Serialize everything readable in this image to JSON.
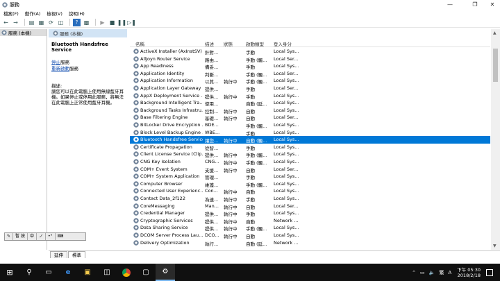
{
  "window": {
    "title": "服務"
  },
  "menu": [
    "檔案(F)",
    "動作(A)",
    "檢視(V)",
    "說明(H)"
  ],
  "tree": {
    "root_label": "服務 (本機)"
  },
  "content_header": "服務 (本機)",
  "description": {
    "service_name": "Bluetooth Handsfree Service",
    "stop_link": "停止",
    "stop_suffix": "服務",
    "restart_link": "重新啟動",
    "restart_suffix": "服務",
    "label": "描述:",
    "text": "讓您可以在此電腦上使用無線藍牙耳機。如果停止或停用此服務，將無法在此電腦上正常使用藍牙耳機。"
  },
  "columns": [
    "名稱",
    "描述",
    "狀態",
    "啟動類型",
    "登入身分"
  ],
  "rows": [
    {
      "name": "ActiveX Installer (AxInstSV)",
      "desc": "針對...",
      "status": "",
      "startup": "手動",
      "logon": "Local Sys..."
    },
    {
      "name": "AllJoyn Router Service",
      "desc": "路由...",
      "status": "",
      "startup": "手動 (觸...",
      "logon": "Local Ser..."
    },
    {
      "name": "App Readiness",
      "desc": "備妥...",
      "status": "",
      "startup": "手動",
      "logon": "Local Sys..."
    },
    {
      "name": "Application Identity",
      "desc": "判斷...",
      "status": "",
      "startup": "手動 (觸...",
      "logon": "Local Ser..."
    },
    {
      "name": "Application Information",
      "desc": "以其...",
      "status": "執行中",
      "startup": "手動 (觸...",
      "logon": "Local Sys..."
    },
    {
      "name": "Application Layer Gateway ...",
      "desc": "提供...",
      "status": "",
      "startup": "手動",
      "logon": "Local Ser..."
    },
    {
      "name": "AppX Deployment Service ...",
      "desc": "提供...",
      "status": "執行中",
      "startup": "手動",
      "logon": "Local Sys..."
    },
    {
      "name": "Background Intelligent Tra...",
      "desc": "使用...",
      "status": "",
      "startup": "自動 (延...",
      "logon": "Local Sys..."
    },
    {
      "name": "Background Tasks Infrastru...",
      "desc": "控制...",
      "status": "執行中",
      "startup": "自動",
      "logon": "Local Sys..."
    },
    {
      "name": "Base Filtering Engine",
      "desc": "基礎...",
      "status": "執行中",
      "startup": "自動",
      "logon": "Local Ser..."
    },
    {
      "name": "BitLocker Drive Encryption ...",
      "desc": "BDE...",
      "status": "",
      "startup": "手動 (觸...",
      "logon": "Local Sys..."
    },
    {
      "name": "Block Level Backup Engine ...",
      "desc": "WBE...",
      "status": "",
      "startup": "手動",
      "logon": "Local Sys..."
    },
    {
      "name": "Bluetooth Handsfree Service",
      "desc": "讓您...",
      "status": "執行中",
      "startup": "自動 (觸...",
      "logon": "Local Sys...",
      "selected": true
    },
    {
      "name": "Certificate Propagation",
      "desc": "從智...",
      "status": "",
      "startup": "手動",
      "logon": "Local Sys..."
    },
    {
      "name": "Client License Service (Clip...",
      "desc": "提供...",
      "status": "執行中",
      "startup": "手動 (觸...",
      "logon": "Local Sys..."
    },
    {
      "name": "CNG Key Isolation",
      "desc": "CNG...",
      "status": "執行中",
      "startup": "手動 (觸...",
      "logon": "Local Sys..."
    },
    {
      "name": "COM+ Event System",
      "desc": "支援...",
      "status": "執行中",
      "startup": "自動",
      "logon": "Local Ser..."
    },
    {
      "name": "COM+ System Application",
      "desc": "管理...",
      "status": "",
      "startup": "手動",
      "logon": "Local Sys..."
    },
    {
      "name": "Computer Browser",
      "desc": "維護...",
      "status": "",
      "startup": "手動 (觸...",
      "logon": "Local Sys..."
    },
    {
      "name": "Connected User Experienc...",
      "desc": "Con...",
      "status": "執行中",
      "startup": "自動",
      "logon": "Local Sys..."
    },
    {
      "name": "Contact Data_2f122",
      "desc": "為連...",
      "status": "執行中",
      "startup": "手動",
      "logon": "Local Sys..."
    },
    {
      "name": "CoreMessaging",
      "desc": "Man...",
      "status": "執行中",
      "startup": "自動",
      "logon": "Local Ser..."
    },
    {
      "name": "Credential Manager",
      "desc": "提供...",
      "status": "執行中",
      "startup": "手動",
      "logon": "Local Sys..."
    },
    {
      "name": "Cryptographic Services",
      "desc": "提供...",
      "status": "執行中",
      "startup": "自動",
      "logon": "Network ..."
    },
    {
      "name": "Data Sharing Service",
      "desc": "提供...",
      "status": "執行中",
      "startup": "手動 (觸...",
      "logon": "Local Sys..."
    },
    {
      "name": "DCOM Server Process Lau...",
      "desc": "DCO...",
      "status": "執行中",
      "startup": "自動",
      "logon": "Local Sys..."
    },
    {
      "name": "Delivery Optimization",
      "desc": "執行...",
      "status": "",
      "startup": "自動 (延...",
      "logon": "Network ..."
    }
  ],
  "tabs": [
    "延伸",
    "標準"
  ],
  "ime": [
    "暫 按",
    "中",
    "ノ",
    "•°"
  ],
  "tray": {
    "lang": "繁",
    "ime_mode": "A",
    "time": "下午 05:30",
    "date": "2018/2/18"
  },
  "colors": {
    "selection": "#0078d7",
    "header_bg": "#d2e4f5",
    "taskbar": "#101010"
  }
}
